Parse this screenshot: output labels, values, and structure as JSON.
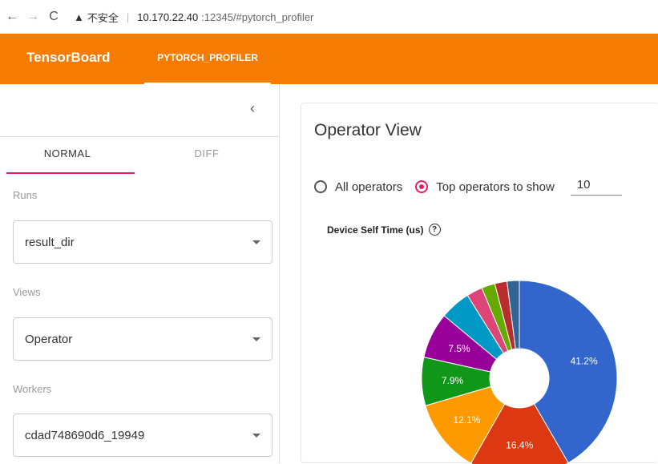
{
  "browser": {
    "back": "←",
    "forward": "→",
    "reload": "C",
    "warning_icon": "▲",
    "insecure_label": "不安全",
    "url_host": "10.170.22.40",
    "url_rest": ":12345/#pytorch_profiler"
  },
  "header": {
    "title": "TensorBoard",
    "tab": "PYTORCH_PROFILER",
    "bg_color": "#f57c00"
  },
  "sidebar": {
    "collapse_icon": "‹",
    "tabs": [
      "NORMAL",
      "DIFF"
    ],
    "runs_label": "Runs",
    "runs_value": "result_dir",
    "views_label": "Views",
    "views_value": "Operator",
    "workers_label": "Workers",
    "workers_value": "cdad748690d6_19949"
  },
  "main": {
    "title": "Operator View",
    "radio_all": "All operators",
    "radio_top": "Top operators to show",
    "top_n": "10",
    "chart_title": "Device Self Time (us)",
    "help_icon": "?"
  },
  "chart_data": {
    "type": "pie",
    "donut": true,
    "values": [
      41.2,
      16.4,
      12.1,
      7.9,
      7.5,
      5.0,
      2.6,
      2.2,
      2.0,
      2.0
    ],
    "labels": [
      "41.2%",
      "16.4%",
      "12.1%",
      "7.9%",
      "7.5%",
      "",
      "",
      "",
      "",
      ""
    ],
    "colors": [
      "#3366cc",
      "#dc3912",
      "#ff9900",
      "#109618",
      "#990099",
      "#0099c6",
      "#dd4477",
      "#66aa00",
      "#b82e2e",
      "#316395"
    ]
  }
}
